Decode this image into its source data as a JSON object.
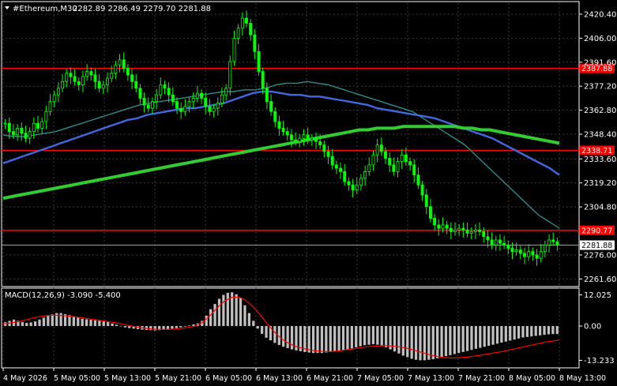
{
  "header": {
    "symbol": "#Ethereum,M30",
    "ohlc": "2282.89 2286.49 2279.70 2281.88"
  },
  "macd_header": {
    "label": "MACD(12,26,9) -3.090 -5.400"
  },
  "colors": {
    "background": "#000000",
    "candle_up": "#00ff00",
    "candle_down": "#00ff00",
    "ma_fast": "#2e8b8b",
    "ma_mid": "#4169e1",
    "ma_slow": "#32cd32",
    "resistance": "#ff0000",
    "current_price_line": "#a0a0a0",
    "macd_hist": "#c0c0c0",
    "macd_signal": "#ff0000",
    "grid": "#3a3a3a"
  },
  "chart_data": [
    {
      "type": "candlestick",
      "title": "#Ethereum,M30",
      "yaxis_ticks": [
        "2420.40",
        "2406.00",
        "2391.60",
        "2377.20",
        "2362.80",
        "2348.40",
        "2333.60",
        "2319.20",
        "2304.80",
        "2276.00",
        "2261.60"
      ],
      "ylim": [
        2258,
        2427
      ],
      "xaxis_ticks": [
        "4 May 2026",
        "5 May 05:00",
        "5 May 13:00",
        "5 May 21:00",
        "6 May 05:00",
        "6 May 13:00",
        "6 May 21:00",
        "7 May 05:00",
        "7 May 13:00",
        "7 May 21:00",
        "8 May 05:00",
        "8 May 13:00"
      ],
      "horizontal_levels": [
        {
          "price": 2387.88,
          "label": "2387.88"
        },
        {
          "price": 2338.71,
          "label": "2338.71"
        },
        {
          "price": 2290.77,
          "label": "2290.77"
        }
      ],
      "current_price": {
        "price": 2281.88,
        "label": "2281.88"
      },
      "close": [
        2355,
        2350,
        2348,
        2352,
        2349,
        2346,
        2350,
        2355,
        2352,
        2356,
        2362,
        2368,
        2372,
        2376,
        2380,
        2385,
        2383,
        2380,
        2378,
        2383,
        2386,
        2384,
        2380,
        2376,
        2378,
        2382,
        2385,
        2390,
        2393,
        2388,
        2384,
        2380,
        2376,
        2370,
        2366,
        2364,
        2368,
        2372,
        2378,
        2376,
        2372,
        2368,
        2364,
        2362,
        2365,
        2368,
        2370,
        2373,
        2370,
        2365,
        2362,
        2364,
        2367,
        2372,
        2376,
        2392,
        2406,
        2412,
        2418,
        2415,
        2408,
        2398,
        2386,
        2376,
        2368,
        2362,
        2356,
        2352,
        2350,
        2348,
        2345,
        2344,
        2346,
        2348,
        2345,
        2346,
        2344,
        2342,
        2338,
        2335,
        2330,
        2328,
        2326,
        2320,
        2318,
        2315,
        2318,
        2322,
        2326,
        2330,
        2336,
        2342,
        2338,
        2334,
        2330,
        2326,
        2332,
        2336,
        2332,
        2330,
        2324,
        2318,
        2312,
        2305,
        2298,
        2294,
        2292,
        2294,
        2292,
        2290,
        2291,
        2292,
        2291,
        2289,
        2290,
        2291,
        2290,
        2287,
        2285,
        2282,
        2285,
        2283,
        2282,
        2280,
        2278,
        2279,
        2277,
        2275,
        2278,
        2276,
        2274,
        2278,
        2282,
        2285,
        2284,
        2282
      ]
    },
    {
      "type": "line",
      "title": "Moving averages",
      "series": [
        {
          "values": [
            2348,
            2347,
            2347,
            2348,
            2349,
            2350,
            2352,
            2354,
            2356,
            2358,
            2360,
            2362,
            2364,
            2366,
            2367,
            2368,
            2369,
            2370,
            2371,
            2372,
            2373,
            2374,
            2374,
            2375,
            2375,
            2376,
            2378,
            2379,
            2379,
            2380,
            2379,
            2378,
            2376,
            2374,
            2372,
            2370,
            2368,
            2366,
            2364,
            2362,
            2358,
            2354,
            2350,
            2346,
            2342,
            2336,
            2330,
            2324,
            2318,
            2312,
            2306,
            2300,
            2296,
            2292
          ]
        },
        {
          "values": [
            2331,
            2333,
            2335,
            2337,
            2339,
            2341,
            2343,
            2345,
            2347,
            2349,
            2351,
            2353,
            2355,
            2357,
            2358,
            2360,
            2361,
            2362,
            2363,
            2364,
            2364,
            2365,
            2366,
            2367,
            2369,
            2371,
            2373,
            2374,
            2374,
            2373,
            2372,
            2372,
            2371,
            2371,
            2370,
            2369,
            2368,
            2367,
            2366,
            2364,
            2363,
            2362,
            2361,
            2360,
            2359,
            2358,
            2356,
            2354,
            2352,
            2350,
            2348,
            2346,
            2343,
            2340,
            2337,
            2334,
            2331,
            2328,
            2324
          ]
        },
        {
          "values": [
            2310,
            2311,
            2312,
            2313,
            2314,
            2315,
            2316,
            2317,
            2318,
            2319,
            2320,
            2321,
            2322,
            2323,
            2324,
            2325,
            2326,
            2327,
            2328,
            2329,
            2330,
            2331,
            2332,
            2333,
            2334,
            2335,
            2336,
            2337,
            2338,
            2339,
            2340,
            2341,
            2342,
            2343,
            2344,
            2345,
            2346,
            2347,
            2348,
            2349,
            2350,
            2351,
            2351,
            2352,
            2352,
            2352,
            2353,
            2353,
            2353,
            2353,
            2353,
            2353,
            2353,
            2352,
            2352,
            2351,
            2351,
            2350,
            2349,
            2348,
            2347,
            2346,
            2345,
            2344,
            2343
          ]
        }
      ]
    },
    {
      "type": "bar",
      "title": "MACD(12,26,9) -3.090 -5.400",
      "yaxis_ticks": [
        "12.025",
        "0.00",
        "-13.233"
      ],
      "ylim": [
        -15.5,
        14
      ],
      "histogram": [
        1.5,
        2,
        2.5,
        2,
        1.5,
        1.2,
        1.4,
        1.8,
        2.5,
        3.2,
        4,
        4.5,
        5,
        5,
        4.6,
        4.2,
        3.6,
        3.2,
        2.8,
        2.6,
        2.4,
        2.2,
        2,
        1.8,
        1.5,
        1,
        0.5,
        0,
        -0.5,
        -0.8,
        -1,
        -1.2,
        -1.4,
        -1.5,
        -1.6,
        -1.7,
        -1.6,
        -1.5,
        -1.2,
        -1,
        -0.8,
        -0.5,
        -0.2,
        0.2,
        0.6,
        1,
        2,
        4,
        6.5,
        8.5,
        10.5,
        12,
        12.8,
        13,
        12.2,
        11,
        8,
        5,
        2,
        -1,
        -3,
        -4.5,
        -5.5,
        -6.5,
        -7.3,
        -8,
        -8.5,
        -9,
        -9.4,
        -9.7,
        -10,
        -10.2,
        -10.4,
        -10.4,
        -10.4,
        -10.2,
        -10,
        -9.8,
        -9.6,
        -9.4,
        -9,
        -8.6,
        -8.2,
        -7.8,
        -7.4,
        -7.2,
        -7,
        -7.2,
        -7.6,
        -8.2,
        -9,
        -9.8,
        -10.6,
        -11.4,
        -12,
        -12.6,
        -13,
        -13.2,
        -13.2,
        -13,
        -12.8,
        -12.4,
        -12,
        -11.6,
        -11.2,
        -10.8,
        -10.4,
        -10,
        -9.6,
        -9.2,
        -8.8,
        -8.4,
        -8,
        -7.6,
        -7.2,
        -6.8,
        -6.4,
        -6,
        -5.6,
        -5.2,
        -4.8,
        -4.4,
        -4.2,
        -4,
        -3.8,
        -3.6,
        -3.4,
        -3.2,
        -3.1,
        -3.09
      ],
      "signal": [
        0.8,
        1.2,
        1.6,
        2.2,
        3,
        3.6,
        4,
        4.2,
        4.1,
        3.9,
        3.6,
        3.2,
        2.8,
        2.4,
        2,
        1.6,
        1.2,
        0.6,
        0,
        -0.5,
        -0.9,
        -1.2,
        -1.3,
        -1.3,
        -1.2,
        -0.9,
        -0.5,
        0,
        1.5,
        4,
        7,
        9.5,
        11,
        11.2,
        10,
        7.5,
        4.5,
        1,
        -2.2,
        -4.8,
        -6.6,
        -7.8,
        -8.6,
        -9.2,
        -9.6,
        -9.8,
        -9.8,
        -9.6,
        -9.2,
        -8.8,
        -8.4,
        -8,
        -7.8,
        -7.6,
        -7.6,
        -7.8,
        -8.2,
        -8.8,
        -9.6,
        -10.4,
        -11.2,
        -11.8,
        -12.2,
        -12.3,
        -12.2,
        -12,
        -11.6,
        -11.2,
        -10.8,
        -10.3,
        -9.8,
        -9.2,
        -8.6,
        -8,
        -7.4,
        -6.8,
        -6.2,
        -5.8,
        -5.4
      ]
    }
  ]
}
